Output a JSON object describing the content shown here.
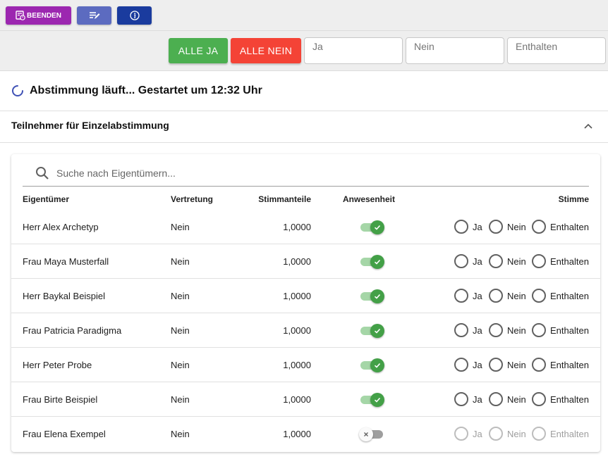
{
  "toolbar": {
    "end_label": "BEENDEN",
    "end_icon": "timer-stop-icon",
    "edit_icon": "edit-list-icon",
    "info_icon": "info-icon",
    "colors": {
      "end": "#9c27b0",
      "edit": "#5c6bc0",
      "info": "#1a3b9e"
    }
  },
  "actions": {
    "all_yes": "ALLE JA",
    "all_no": "ALLE NEIN",
    "yes_placeholder": "Ja",
    "no_placeholder": "Nein",
    "abstain_placeholder": "Enthalten",
    "colors": {
      "yes": "#4caf50",
      "no": "#f44336"
    }
  },
  "status": {
    "text": "Abstimmung läuft... Gestartet um 12:32 Uhr"
  },
  "section": {
    "title": "Teilnehmer für Einzelabstimmung",
    "expanded": true
  },
  "search": {
    "placeholder": "Suche nach Eigentümern..."
  },
  "table": {
    "headers": {
      "owner": "Eigentümer",
      "rep": "Vertretung",
      "shares": "Stimmanteile",
      "presence": "Anwesenheit",
      "vote": "Stimme"
    },
    "vote_options": [
      "Ja",
      "Nein",
      "Enthalten"
    ],
    "rows": [
      {
        "name": "Herr Alex Archetyp",
        "rep": "Nein",
        "shares": "1,0000",
        "present": true
      },
      {
        "name": "Frau Maya Musterfall",
        "rep": "Nein",
        "shares": "1,0000",
        "present": true
      },
      {
        "name": "Herr Baykal Beispiel",
        "rep": "Nein",
        "shares": "1,0000",
        "present": true
      },
      {
        "name": "Frau Patricia Paradigma",
        "rep": "Nein",
        "shares": "1,0000",
        "present": true
      },
      {
        "name": "Herr Peter Probe",
        "rep": "Nein",
        "shares": "1,0000",
        "present": true
      },
      {
        "name": "Frau Birte Beispiel",
        "rep": "Nein",
        "shares": "1,0000",
        "present": true
      },
      {
        "name": "Frau Elena Exempel",
        "rep": "Nein",
        "shares": "1,0000",
        "present": false
      }
    ]
  }
}
